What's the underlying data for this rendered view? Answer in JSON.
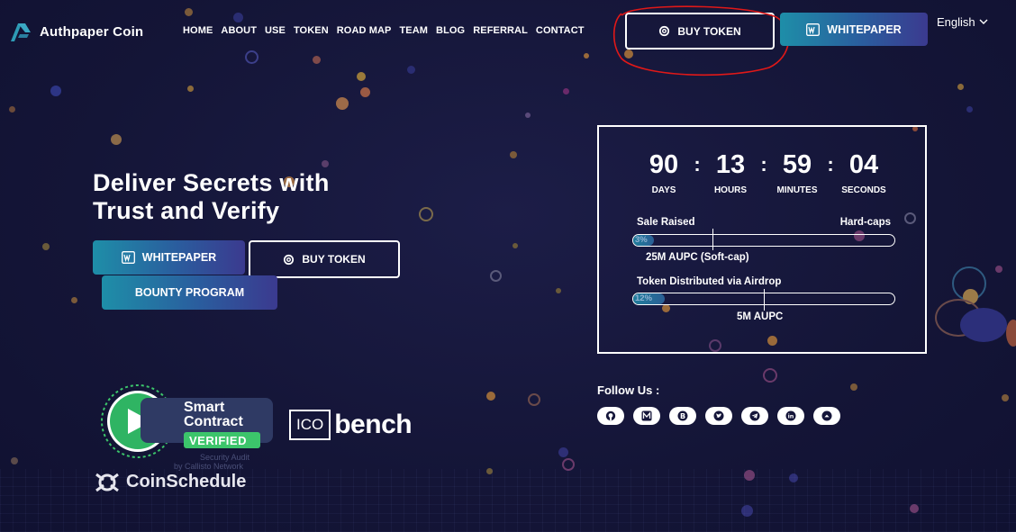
{
  "header": {
    "brand": "Authpaper Coin",
    "nav": [
      "HOME",
      "ABOUT",
      "USE",
      "TOKEN",
      "ROAD MAP",
      "TEAM",
      "BLOG",
      "REFERRAL",
      "CONTACT"
    ],
    "buy_token": "BUY TOKEN",
    "whitepaper": "WHITEPAPER",
    "language": "English"
  },
  "hero": {
    "title_line1": "Deliver Secrets with",
    "title_line2": "Trust and Verify",
    "whitepaper": "WHITEPAPER",
    "buy_token": "BUY TOKEN",
    "bounty": "BOUNTY PROGRAM"
  },
  "countdown": {
    "days": "90",
    "days_label": "DAYS",
    "hours": "13",
    "hours_label": "HOURS",
    "minutes": "59",
    "minutes_label": "MINUTES",
    "seconds": "04",
    "seconds_label": "SECONDS"
  },
  "sale": {
    "raised_label": "Sale Raised",
    "hardcap_label": "Hard-caps",
    "progress_text": "3%",
    "progress": 0.08,
    "softcap_label": "25M AUPC (Soft-cap)"
  },
  "airdrop": {
    "label": "Token Distributed via Airdrop",
    "progress_text": "12%",
    "progress": 0.12,
    "target_label": "5M AUPC"
  },
  "follow": {
    "label": "Follow Us :",
    "icons": [
      "github-icon",
      "medium-icon",
      "bitcoin-icon",
      "twitter-icon",
      "telegram-icon",
      "linkedin-icon",
      "chevron-up-icon"
    ]
  },
  "badges": {
    "smart_contract_1": "Smart",
    "smart_contract_2": "Contract",
    "verified": "VERIFIED",
    "audit": "Security Audit",
    "audit_by": "by Callisto Network",
    "ico": "ICO",
    "bench": "bench",
    "coinschedule": "CoinSchedule"
  },
  "colors": {
    "background": "#15163a",
    "accent_teal": "#1e8ea8",
    "accent_indigo": "#3b3a8f",
    "verified_green": "#3cc56b",
    "annotation_red": "#e01818"
  }
}
